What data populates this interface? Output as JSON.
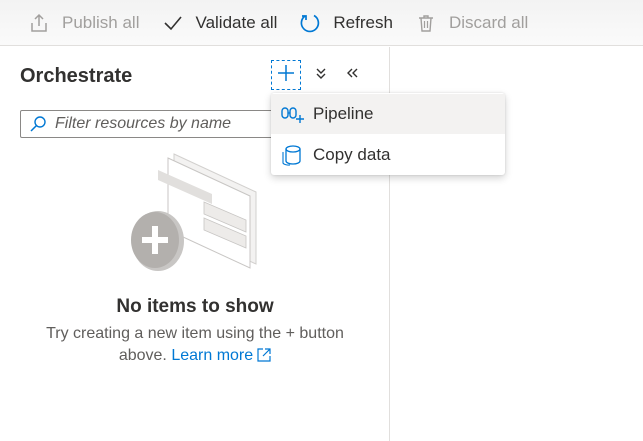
{
  "toolbar": {
    "publish_label": "Publish all",
    "validate_label": "Validate all",
    "refresh_label": "Refresh",
    "discard_label": "Discard all"
  },
  "pane": {
    "title": "Orchestrate",
    "filter_placeholder": "Filter resources by name"
  },
  "empty_state": {
    "title": "No items to show",
    "desc_line1": "Try creating a new item using the + button",
    "desc_line2": "above.",
    "learn_more": "Learn more"
  },
  "add_menu": {
    "items": [
      {
        "label": "Pipeline",
        "icon": "pipeline-icon"
      },
      {
        "label": "Copy data",
        "icon": "copy-data-icon"
      }
    ]
  },
  "colors": {
    "accent": "#0078d4",
    "text": "#323130",
    "disabled": "#a19f9d"
  }
}
